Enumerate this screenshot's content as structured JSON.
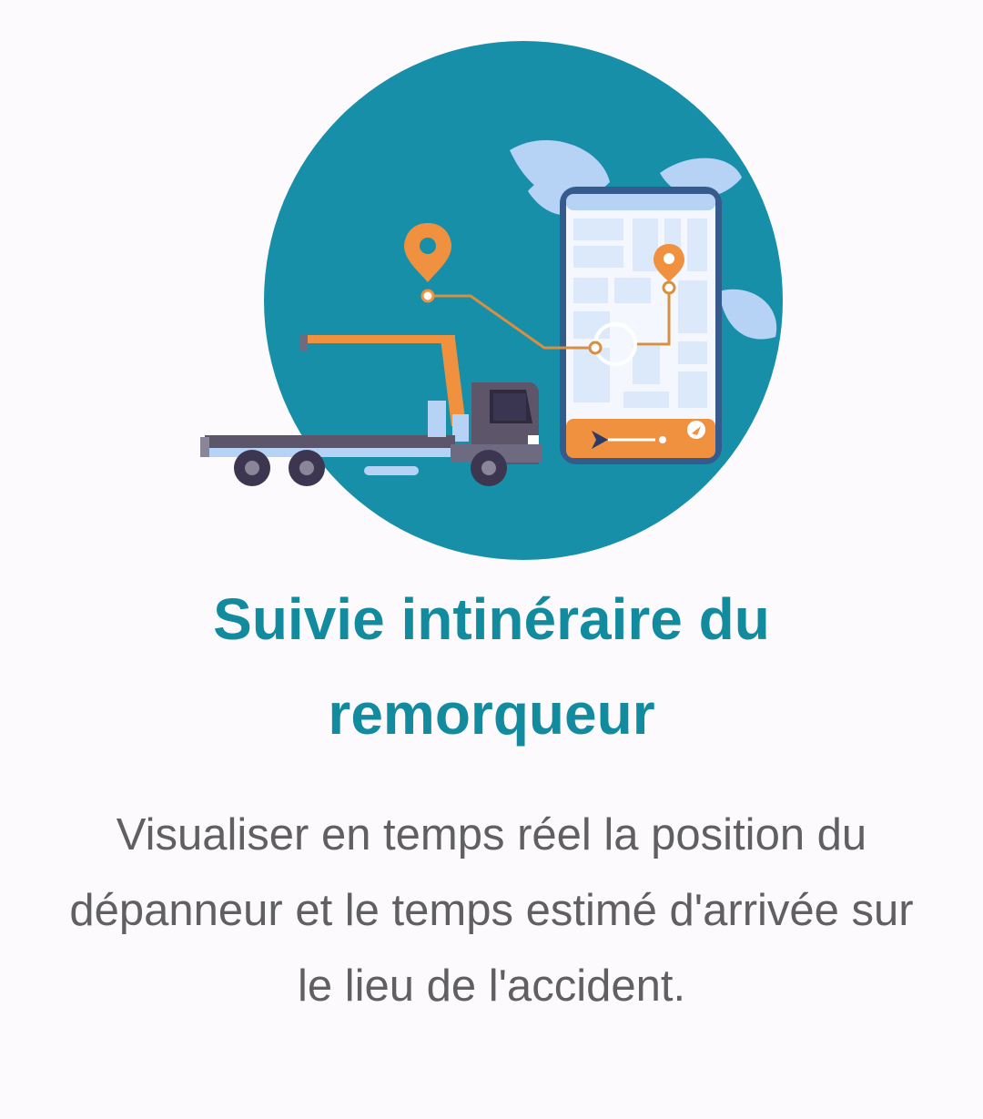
{
  "onboarding": {
    "illustration_icon": "tow-truck-tracking-illustration",
    "title": "Suivie intinéraire du remorqueur",
    "description": "Visualiser en temps réel la position du dépanneur et le temps estimé d'arrivée sur le lieu de l'accident."
  },
  "colors": {
    "background": "#fcfafd",
    "circle": "#178fa9",
    "title": "#128b9f",
    "description": "#606063",
    "accent_orange": "#f0913f",
    "truck_body": "#5d566b",
    "phone_map": "#dbe9fb"
  }
}
